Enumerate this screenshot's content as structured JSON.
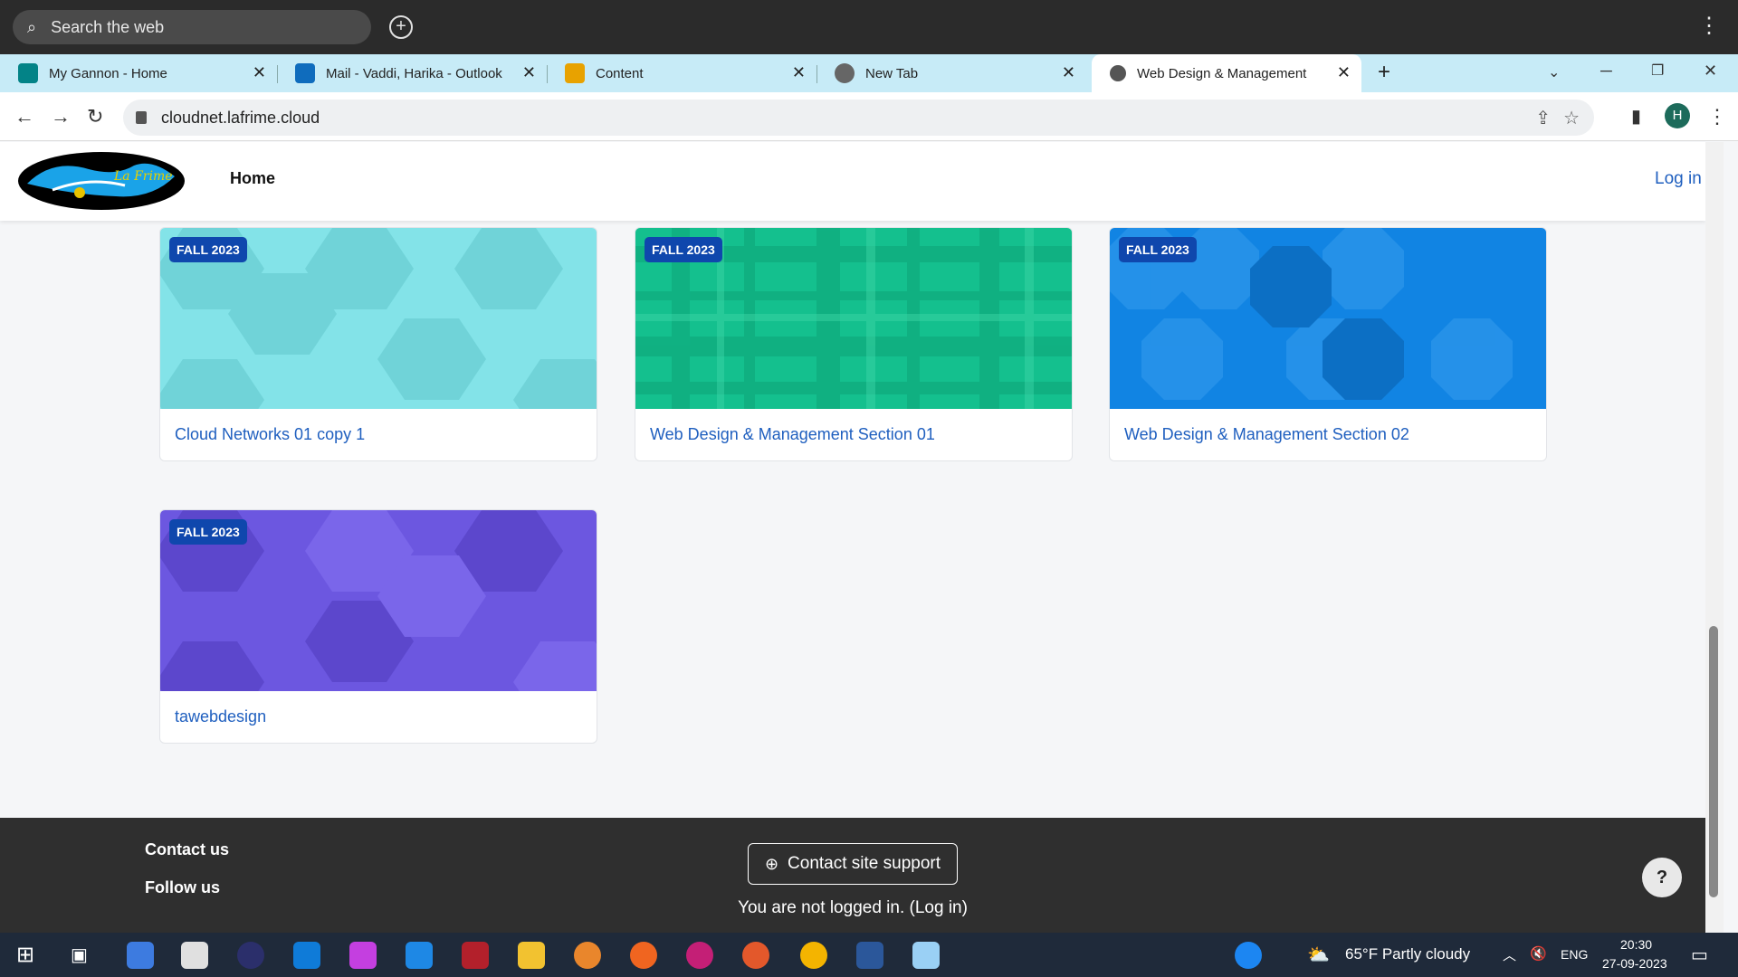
{
  "os_search": {
    "placeholder": "Search the web"
  },
  "tabs": [
    {
      "label": "My Gannon - Home",
      "icon": "sharepoint-icon",
      "color": "#038387"
    },
    {
      "label": "Mail - Vaddi, Harika - Outlook",
      "icon": "outlook-icon",
      "color": "#0f6cbd"
    },
    {
      "label": "Content",
      "icon": "bar-chart-icon",
      "color": "#e8a200"
    },
    {
      "label": "New Tab",
      "icon": "chrome-icon",
      "color": "#666666"
    },
    {
      "label": "Web Design & Management",
      "icon": "globe-icon",
      "color": "#555555",
      "active": true
    }
  ],
  "address": {
    "url": "cloudnet.lafrime.cloud"
  },
  "profile": {
    "initial": "H"
  },
  "site": {
    "home": "Home",
    "login": "Log in"
  },
  "courses": [
    {
      "badge": "FALL 2023",
      "title": "Cloud Networks 01 copy 1",
      "bg": "#83e3e8",
      "shade": "#6fcfd4"
    },
    {
      "badge": "FALL 2023",
      "title": "Web Design & Management Section 01",
      "bg": "#14c08e",
      "shade": "#0ea77a"
    },
    {
      "badge": "FALL 2023",
      "title": "Web Design & Management Section 02",
      "bg": "#1184e3",
      "shade": "#0c6fc4"
    },
    {
      "badge": "FALL 2023",
      "title": "tawebdesign",
      "bg": "#6c57e0",
      "shade": "#5c47cc"
    }
  ],
  "footer": {
    "contact": "Contact us",
    "follow": "Follow us",
    "support": "Contact site support",
    "status": "You are not logged in. (Log in)",
    "help": "?"
  },
  "taskbar": {
    "weather": "65°F  Partly cloudy",
    "lang": "ENG",
    "time": "20:30",
    "date": "27-09-2023"
  }
}
